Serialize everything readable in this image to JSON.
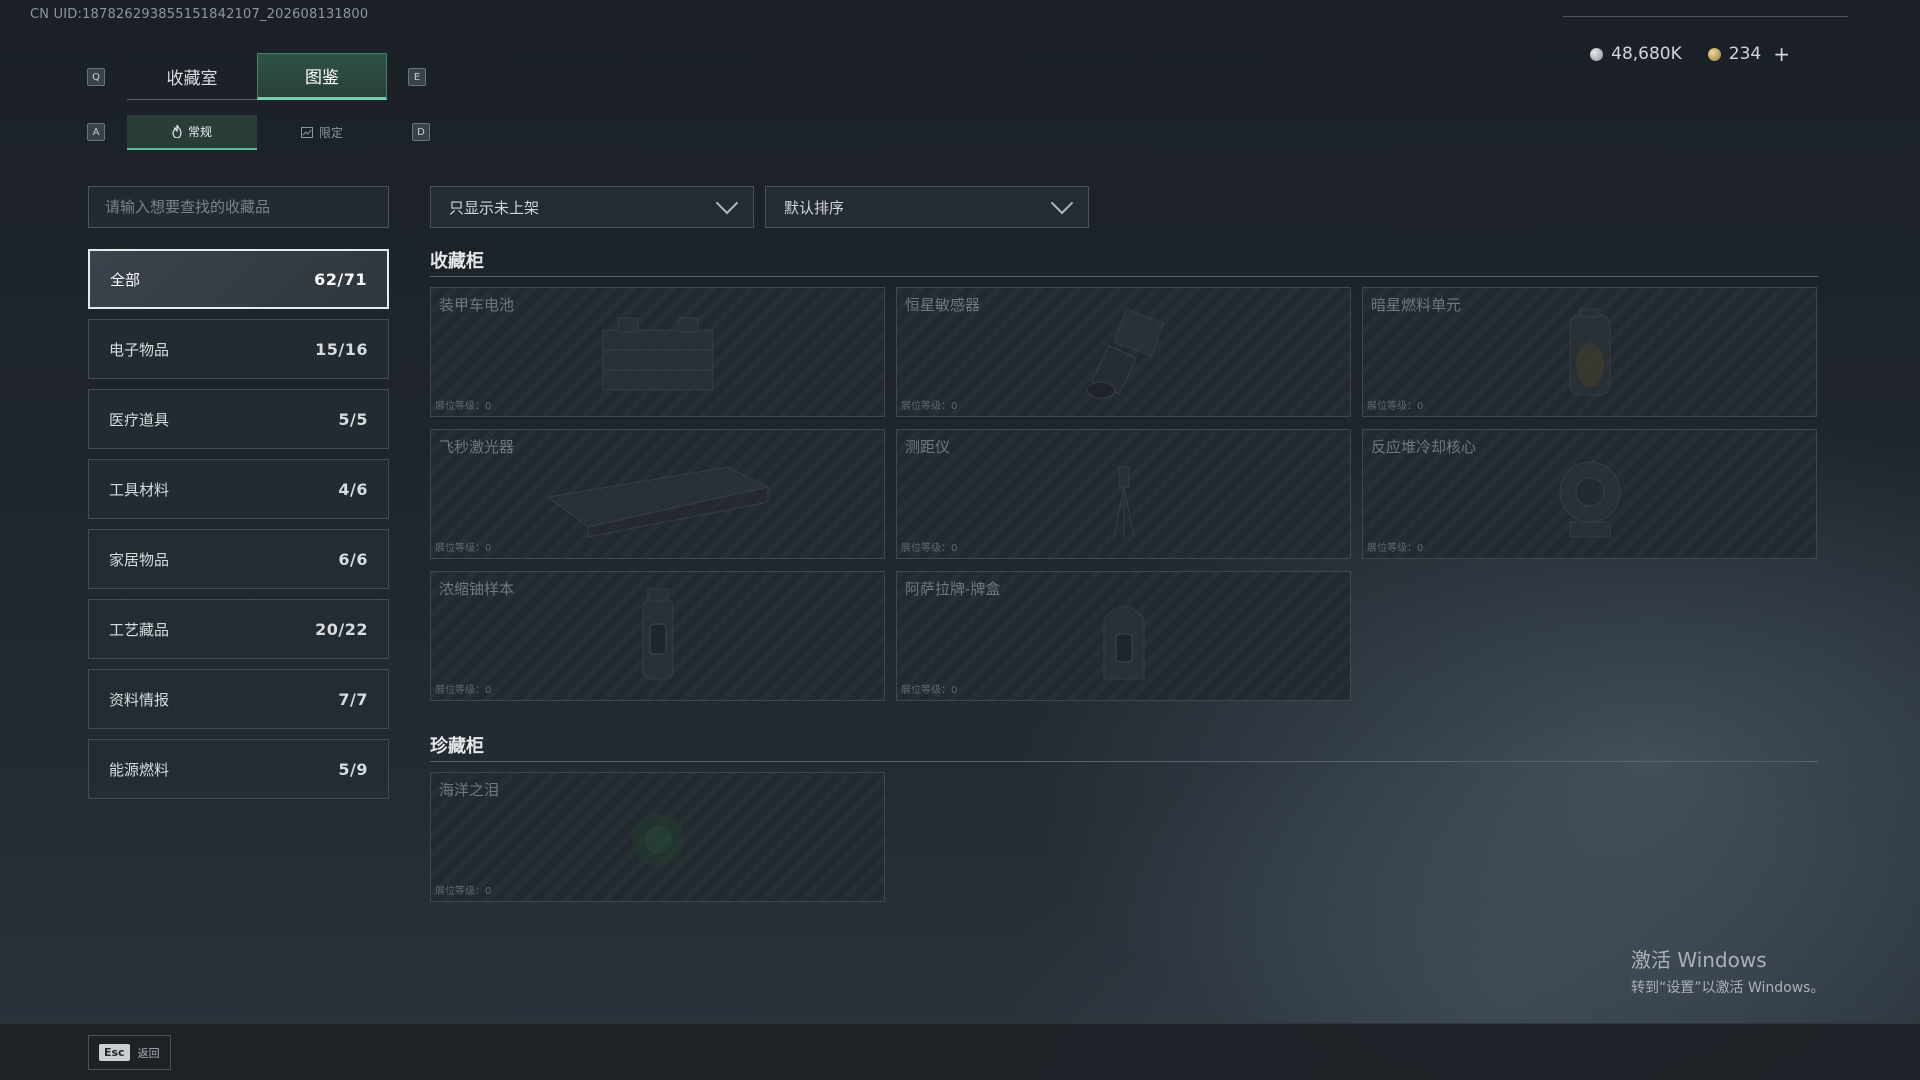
{
  "header": {
    "uid": "CN UID:1878262938551518421​07_202608131800",
    "silver_amount": "48,680K",
    "gold_amount": "234",
    "plus": "+"
  },
  "keys": {
    "q": "Q",
    "e": "E",
    "a": "A",
    "d": "D"
  },
  "tabs_main": [
    {
      "label": "收藏室",
      "active": false
    },
    {
      "label": "图鉴",
      "active": true
    }
  ],
  "tabs_sub": [
    {
      "label": "常规",
      "active": true
    },
    {
      "label": "限定",
      "active": false
    }
  ],
  "search": {
    "placeholder": "请输入想要查找的收藏品"
  },
  "categories": [
    {
      "label": "全部",
      "count": "62/71",
      "active": true
    },
    {
      "label": "电子物品",
      "count": "15/16"
    },
    {
      "label": "医疗道具",
      "count": "5/5"
    },
    {
      "label": "工具材料",
      "count": "4/6"
    },
    {
      "label": "家居物品",
      "count": "6/6"
    },
    {
      "label": "工艺藏品",
      "count": "20/22"
    },
    {
      "label": "资料情报",
      "count": "7/7"
    },
    {
      "label": "能源燃料",
      "count": "5/9"
    }
  ],
  "filters": {
    "show_filter": "只显示未上架",
    "sort": "默认排序"
  },
  "sections": {
    "cabinet_title": "收藏柜",
    "treasure_title": "珍藏柜"
  },
  "cabinet_items": [
    {
      "name": "装甲车电池",
      "level": "展位等级：0",
      "icon": "battery-icon"
    },
    {
      "name": "恒星敏感器",
      "level": "展位等级：0",
      "icon": "sensor-icon"
    },
    {
      "name": "暗星燃料单元",
      "level": "展位等级：0",
      "icon": "fuel-cell-icon"
    },
    {
      "name": "飞秒激光器",
      "level": "展位等级：0",
      "icon": "laser-icon"
    },
    {
      "name": "测距仪",
      "level": "展位等级：0",
      "icon": "rangefinder-icon"
    },
    {
      "name": "反应堆冷却核心",
      "level": "展位等级：0",
      "icon": "reactor-core-icon"
    },
    {
      "name": "浓缩铀样本",
      "level": "展位等级：0",
      "icon": "uranium-sample-icon"
    },
    {
      "name": "阿萨拉牌-牌盒",
      "level": "展位等级：0",
      "icon": "card-box-icon"
    }
  ],
  "treasure_items": [
    {
      "name": "海洋之泪",
      "level": "展位等级：0",
      "icon": "gem-icon"
    }
  ],
  "footer": {
    "esc_key": "Esc",
    "back_label": "返回"
  },
  "watermark": {
    "line1": "激活 Windows",
    "line2": "转到“设置”以激活 Windows。"
  },
  "colors": {
    "accent": "#6fd1ad",
    "background": "#1e252b"
  }
}
